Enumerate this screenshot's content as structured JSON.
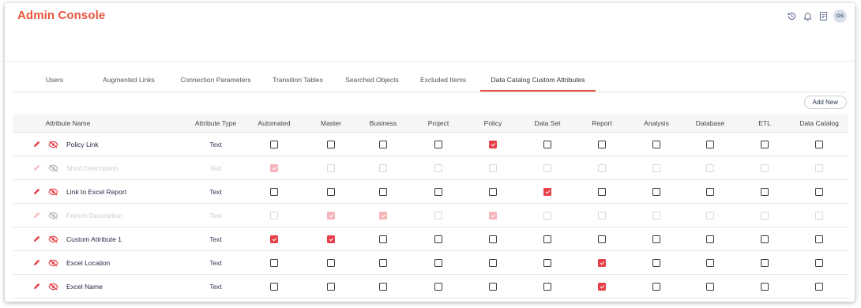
{
  "header": {
    "title": "Admin Console",
    "avatar_initials": "OS"
  },
  "tabs": [
    {
      "label": "Users",
      "active": false
    },
    {
      "label": "Augmented Links",
      "active": false
    },
    {
      "label": "Connection Parameters",
      "active": false
    },
    {
      "label": "Transition Tables",
      "active": false
    },
    {
      "label": "Searched Objects",
      "active": false
    },
    {
      "label": "Excluded Items",
      "active": false
    },
    {
      "label": "Data Catalog Custom Attributes",
      "active": true
    }
  ],
  "toolbar": {
    "add_new_label": "Add New"
  },
  "table": {
    "columns": [
      "Attribute Name",
      "Attribute Type",
      "Automated",
      "Master",
      "Business",
      "Project",
      "Policy",
      "Data Set",
      "Report",
      "Analysis",
      "Database",
      "ETL",
      "Data Catalog"
    ],
    "rows": [
      {
        "name": "Policy Link",
        "type": "Text",
        "disabled": false,
        "checks": [
          false,
          false,
          false,
          false,
          true,
          false,
          false,
          false,
          false,
          false,
          false
        ]
      },
      {
        "name": "Short Description",
        "type": "Text",
        "disabled": true,
        "checks": [
          true,
          false,
          false,
          false,
          false,
          false,
          false,
          false,
          false,
          false,
          false
        ]
      },
      {
        "name": "Link to Excel Report",
        "type": "Text",
        "disabled": false,
        "checks": [
          false,
          false,
          false,
          false,
          false,
          true,
          false,
          false,
          false,
          false,
          false
        ]
      },
      {
        "name": "French Description",
        "type": "Text",
        "disabled": true,
        "checks": [
          false,
          true,
          true,
          false,
          true,
          false,
          false,
          false,
          false,
          false,
          false
        ]
      },
      {
        "name": "Custom Attribute 1",
        "type": "Text",
        "disabled": false,
        "checks": [
          true,
          true,
          false,
          false,
          false,
          false,
          false,
          false,
          false,
          false,
          false
        ]
      },
      {
        "name": "Excel Location",
        "type": "Text",
        "disabled": false,
        "checks": [
          false,
          false,
          false,
          false,
          false,
          false,
          true,
          false,
          false,
          false,
          false
        ]
      },
      {
        "name": "Excel Name",
        "type": "Text",
        "disabled": false,
        "checks": [
          false,
          false,
          false,
          false,
          false,
          false,
          true,
          false,
          false,
          false,
          false
        ]
      }
    ]
  },
  "colors": {
    "accent": "#e8553e",
    "check": "#e8404a"
  },
  "icons": [
    "history-icon",
    "bell-icon",
    "notes-icon",
    "edit-icon",
    "hidden-icon"
  ]
}
